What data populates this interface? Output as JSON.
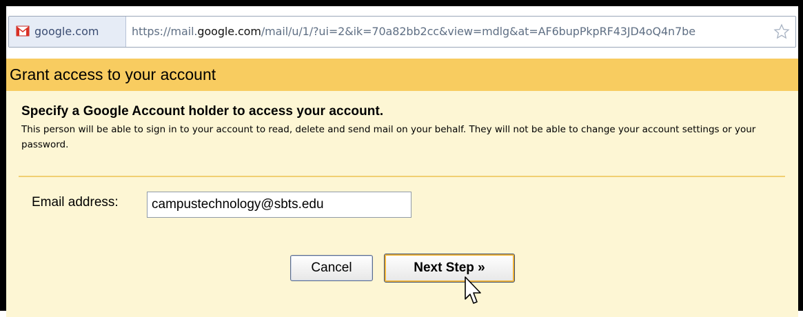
{
  "browser": {
    "site_chip": "google.com",
    "url_prefix": "https://mail.",
    "url_domain": "google.com",
    "url_rest": "/mail/u/1/?ui=2&ik=70a82bb2cc&view=mdlg&at=AF6bupPkpRF43JD4oQ4n7be",
    "favicon_icon": "gmail-icon",
    "bookmark_icon": "star-icon"
  },
  "dialog": {
    "title": "Grant access to your account",
    "heading": "Specify a Google Account holder to access your account.",
    "description": "This person will be able to sign in to your account to read, delete and send mail on your behalf. They will not be able to change your account settings or your password.",
    "email_label": "Email address:",
    "email_value": "campustechnology@sbts.edu",
    "cancel_label": "Cancel",
    "next_label": "Next Step »",
    "pointer_icon": "mouse-pointer-icon"
  },
  "colors": {
    "header_bg": "#f8cc60",
    "body_bg": "#fdf6d4",
    "divider": "#f1cf71",
    "button_focus": "#f0b43a"
  }
}
